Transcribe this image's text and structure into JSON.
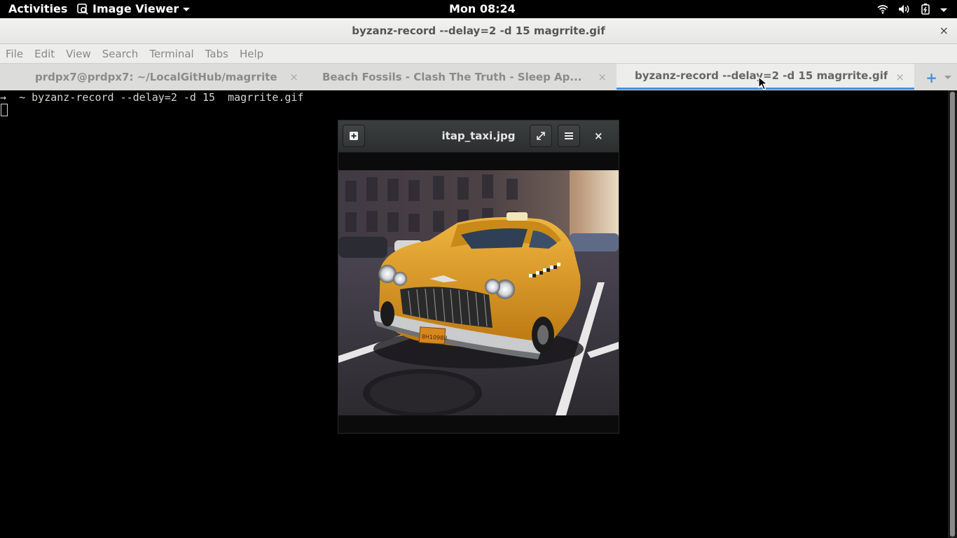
{
  "topbar": {
    "activities": "Activities",
    "app_menu": "Image Viewer",
    "clock": "Mon 08:24"
  },
  "window": {
    "title": "byzanz-record --delay=2 -d 15 magrrite.gif",
    "close": "×"
  },
  "menu": {
    "items": [
      "File",
      "Edit",
      "View",
      "Search",
      "Terminal",
      "Tabs",
      "Help"
    ]
  },
  "tabs": [
    {
      "label": "prdpx7@prdpx7: ~/LocalGitHub/magrrite",
      "active": false
    },
    {
      "label": "Beach Fossils - Clash The Truth - Sleep Ap...",
      "active": false
    },
    {
      "label": "byzanz-record --delay=2 -d 15 magrrite.gif",
      "active": true
    }
  ],
  "terminal": {
    "prompt": "→  ~ byzanz-record --delay=2 -d 15  magrrite.gif"
  },
  "viewer": {
    "title": "itap_taxi.jpg",
    "close": "×",
    "plate_text": "8H10988"
  },
  "colors": {
    "accent": "#4a90d9",
    "taxi_yellow": "#d89a1e"
  },
  "icons": {
    "app_menu": "image-viewer-icon",
    "tray": [
      "wifi-icon",
      "volume-icon",
      "battery-icon",
      "chevron-down-icon"
    ],
    "viewer": [
      "open-image-icon",
      "fullscreen-icon",
      "hamburger-menu-icon",
      "close-icon"
    ]
  }
}
